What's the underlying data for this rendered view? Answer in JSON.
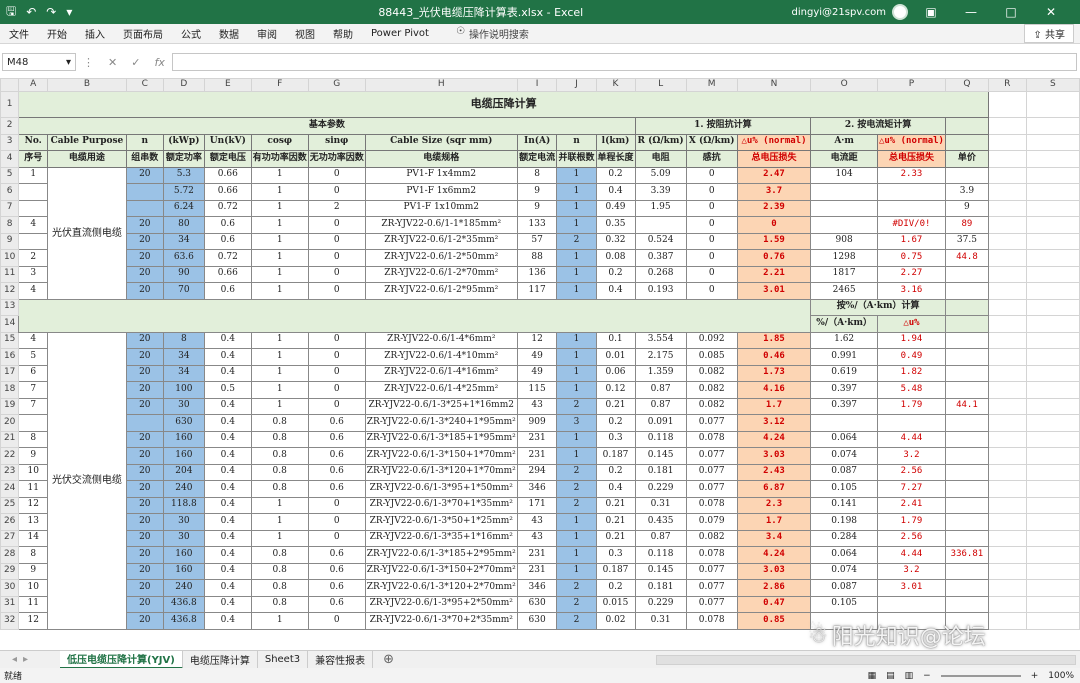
{
  "window": {
    "title": "88443_光伏电缆压降计算表.xlsx  -  Excel",
    "user": "dingyi@21spv.com"
  },
  "ribbon": {
    "tabs": [
      "文件",
      "开始",
      "插入",
      "页面布局",
      "公式",
      "数据",
      "审阅",
      "视图",
      "帮助",
      "Power Pivot"
    ],
    "tell_me": "操作说明搜索",
    "share": "共享"
  },
  "formula_bar": {
    "name_box": "M48",
    "content": ""
  },
  "columns": [
    "A",
    "B",
    "C",
    "D",
    "E",
    "F",
    "G",
    "H",
    "I",
    "J",
    "K",
    "L",
    "M",
    "N",
    "O",
    "P",
    "Q",
    "R",
    "S"
  ],
  "sheet": {
    "title": "电缆压降计算",
    "section_basic": "基本参数",
    "section_imp": "1. 按阻抗计算",
    "section_mom": "2. 按电流矩计算",
    "row3": [
      "No.",
      "Cable Purpose",
      "n",
      "(kWp)",
      "Un(kV)",
      "cosφ",
      "sinφ",
      "Cable Size (sqr mm)",
      "In(A)",
      "n",
      "l(km)",
      "R (Ω/km)",
      "X (Ω/km)",
      "△u% (normal)",
      "A·m",
      "△u% (normal)",
      ""
    ],
    "row4": [
      "序号",
      "电缆用途",
      "组串数",
      "额定功率",
      "额定电压",
      "有功功率因数",
      "无功功率因数",
      "电缆规格",
      "额定电流",
      "并联根数",
      "单程长度",
      "电阻",
      "感抗",
      "总电压损失",
      "电流距",
      "总电压损失",
      "单价"
    ],
    "group_dc": "光伏直流侧电缆",
    "group_ac": "光伏交流侧电缆",
    "band_label": "按%/（A·km）计算",
    "band_sub": "%/（A·km）",
    "band_delta": "△u%",
    "rows_dc": [
      {
        "r": "5",
        "a": "1",
        "c": "20",
        "d": "5.3",
        "e": "0.66",
        "f": "1",
        "g": "0",
        "h": "PV1-F 1x4mm2",
        "i": "8",
        "j": "1",
        "k": "0.2",
        "l": "5.09",
        "m": "0",
        "n": "2.47",
        "o": "104",
        "p": "2.33",
        "q": ""
      },
      {
        "r": "6",
        "a": "",
        "c": "",
        "d": "5.72",
        "e": "0.66",
        "f": "1",
        "g": "0",
        "h": "PV1-F 1x6mm2",
        "i": "9",
        "j": "1",
        "k": "0.4",
        "l": "3.39",
        "m": "0",
        "n": "3.7",
        "o": "",
        "p": "",
        "q": "3.9"
      },
      {
        "r": "7",
        "a": "",
        "c": "",
        "d": "6.24",
        "e": "0.72",
        "f": "1",
        "g": "2",
        "h": "PV1-F 1x10mm2",
        "i": "9",
        "j": "1",
        "k": "0.49",
        "l": "1.95",
        "m": "0",
        "n": "2.39",
        "o": "",
        "p": "",
        "q": "9"
      },
      {
        "r": "8",
        "a": "4",
        "c": "20",
        "d": "80",
        "e": "0.6",
        "f": "1",
        "g": "0",
        "h": "ZR-YJV22-0.6/1-1*185mm²",
        "i": "133",
        "j": "1",
        "k": "0.35",
        "l": "",
        "m": "0",
        "n": "0",
        "o": "",
        "p": "#DIV/0!",
        "q": "89"
      },
      {
        "r": "9",
        "a": "",
        "c": "20",
        "d": "34",
        "e": "0.6",
        "f": "1",
        "g": "0",
        "h": "ZR-YJV22-0.6/1-2*35mm²",
        "i": "57",
        "j": "2",
        "k": "0.32",
        "l": "0.524",
        "m": "0",
        "n": "1.59",
        "o": "908",
        "p": "1.67",
        "q": "37.5"
      },
      {
        "r": "10",
        "a": "2",
        "c": "20",
        "d": "63.6",
        "e": "0.72",
        "f": "1",
        "g": "0",
        "h": "ZR-YJV22-0.6/1-2*50mm²",
        "i": "88",
        "j": "1",
        "k": "0.08",
        "l": "0.387",
        "m": "0",
        "n": "0.76",
        "o": "1298",
        "p": "0.75",
        "q": "44.8"
      },
      {
        "r": "11",
        "a": "3",
        "c": "20",
        "d": "90",
        "e": "0.66",
        "f": "1",
        "g": "0",
        "h": "ZR-YJV22-0.6/1-2*70mm²",
        "i": "136",
        "j": "1",
        "k": "0.2",
        "l": "0.268",
        "m": "0",
        "n": "2.21",
        "o": "1817",
        "p": "2.27",
        "q": ""
      },
      {
        "r": "12",
        "a": "4",
        "c": "20",
        "d": "70",
        "e": "0.6",
        "f": "1",
        "g": "0",
        "h": "ZR-YJV22-0.6/1-2*95mm²",
        "i": "117",
        "j": "1",
        "k": "0.4",
        "l": "0.193",
        "m": "0",
        "n": "3.01",
        "o": "2465",
        "p": "3.16",
        "q": ""
      }
    ],
    "rows_ac": [
      {
        "r": "15",
        "a": "4",
        "c": "20",
        "d": "8",
        "e": "0.4",
        "f": "1",
        "g": "0",
        "h": "ZR-YJV22-0.6/1-4*6mm²",
        "i": "12",
        "j": "1",
        "k": "0.1",
        "l": "3.554",
        "m": "0.092",
        "n": "1.85",
        "o": "1.62",
        "p": "1.94",
        "q": ""
      },
      {
        "r": "16",
        "a": "5",
        "c": "20",
        "d": "34",
        "e": "0.4",
        "f": "1",
        "g": "0",
        "h": "ZR-YJV22-0.6/1-4*10mm²",
        "i": "49",
        "j": "1",
        "k": "0.01",
        "l": "2.175",
        "m": "0.085",
        "n": "0.46",
        "o": "0.991",
        "p": "0.49",
        "q": ""
      },
      {
        "r": "17",
        "a": "6",
        "c": "20",
        "d": "34",
        "e": "0.4",
        "f": "1",
        "g": "0",
        "h": "ZR-YJV22-0.6/1-4*16mm²",
        "i": "49",
        "j": "1",
        "k": "0.06",
        "l": "1.359",
        "m": "0.082",
        "n": "1.73",
        "o": "0.619",
        "p": "1.82",
        "q": ""
      },
      {
        "r": "18",
        "a": "7",
        "c": "20",
        "d": "100",
        "e": "0.5",
        "f": "1",
        "g": "0",
        "h": "ZR-YJV22-0.6/1-4*25mm²",
        "i": "115",
        "j": "1",
        "k": "0.12",
        "l": "0.87",
        "m": "0.082",
        "n": "4.16",
        "o": "0.397",
        "p": "5.48",
        "q": ""
      },
      {
        "r": "19",
        "a": "7",
        "c": "20",
        "d": "30",
        "e": "0.4",
        "f": "1",
        "g": "0",
        "h": "ZR-YJV22-0.6/1-3*25+1*16mm2",
        "i": "43",
        "j": "2",
        "k": "0.21",
        "l": "0.87",
        "m": "0.082",
        "n": "1.7",
        "o": "0.397",
        "p": "1.79",
        "q": "44.1"
      },
      {
        "r": "20",
        "a": "",
        "c": "",
        "d": "630",
        "e": "0.4",
        "f": "0.8",
        "g": "0.6",
        "h": "ZR-YJV22-0.6/1-3*240+1*95mm²",
        "i": "909",
        "j": "3",
        "k": "0.2",
        "l": "0.091",
        "m": "0.077",
        "n": "3.12",
        "o": "",
        "p": "",
        "q": ""
      },
      {
        "r": "21",
        "a": "8",
        "c": "20",
        "d": "160",
        "e": "0.4",
        "f": "0.8",
        "g": "0.6",
        "h": "ZR-YJV22-0.6/1-3*185+1*95mm²",
        "i": "231",
        "j": "1",
        "k": "0.3",
        "l": "0.118",
        "m": "0.078",
        "n": "4.24",
        "o": "0.064",
        "p": "4.44",
        "q": ""
      },
      {
        "r": "22",
        "a": "9",
        "c": "20",
        "d": "160",
        "e": "0.4",
        "f": "0.8",
        "g": "0.6",
        "h": "ZR-YJV22-0.6/1-3*150+1*70mm²",
        "i": "231",
        "j": "1",
        "k": "0.187",
        "l": "0.145",
        "m": "0.077",
        "n": "3.03",
        "o": "0.074",
        "p": "3.2",
        "q": ""
      },
      {
        "r": "23",
        "a": "10",
        "c": "20",
        "d": "204",
        "e": "0.4",
        "f": "0.8",
        "g": "0.6",
        "h": "ZR-YJV22-0.6/1-3*120+1*70mm²",
        "i": "294",
        "j": "2",
        "k": "0.2",
        "l": "0.181",
        "m": "0.077",
        "n": "2.43",
        "o": "0.087",
        "p": "2.56",
        "q": ""
      },
      {
        "r": "24",
        "a": "11",
        "c": "20",
        "d": "240",
        "e": "0.4",
        "f": "0.8",
        "g": "0.6",
        "h": "ZR-YJV22-0.6/1-3*95+1*50mm²",
        "i": "346",
        "j": "2",
        "k": "0.4",
        "l": "0.229",
        "m": "0.077",
        "n": "6.87",
        "o": "0.105",
        "p": "7.27",
        "q": ""
      },
      {
        "r": "25",
        "a": "12",
        "c": "20",
        "d": "118.8",
        "e": "0.4",
        "f": "1",
        "g": "0",
        "h": "ZR-YJV22-0.6/1-3*70+1*35mm²",
        "i": "171",
        "j": "2",
        "k": "0.21",
        "l": "0.31",
        "m": "0.078",
        "n": "2.3",
        "o": "0.141",
        "p": "2.41",
        "q": ""
      },
      {
        "r": "26",
        "a": "13",
        "c": "20",
        "d": "30",
        "e": "0.4",
        "f": "1",
        "g": "0",
        "h": "ZR-YJV22-0.6/1-3*50+1*25mm²",
        "i": "43",
        "j": "1",
        "k": "0.21",
        "l": "0.435",
        "m": "0.079",
        "n": "1.7",
        "o": "0.198",
        "p": "1.79",
        "q": ""
      },
      {
        "r": "27",
        "a": "14",
        "c": "20",
        "d": "30",
        "e": "0.4",
        "f": "1",
        "g": "0",
        "h": "ZR-YJV22-0.6/1-3*35+1*16mm²",
        "i": "43",
        "j": "1",
        "k": "0.21",
        "l": "0.87",
        "m": "0.082",
        "n": "3.4",
        "o": "0.284",
        "p": "2.56",
        "q": ""
      },
      {
        "r": "28",
        "a": "8",
        "c": "20",
        "d": "160",
        "e": "0.4",
        "f": "0.8",
        "g": "0.6",
        "h": "ZR-YJV22-0.6/1-3*185+2*95mm²",
        "i": "231",
        "j": "1",
        "k": "0.3",
        "l": "0.118",
        "m": "0.078",
        "n": "4.24",
        "o": "0.064",
        "p": "4.44",
        "q": "336.81"
      },
      {
        "r": "29",
        "a": "9",
        "c": "20",
        "d": "160",
        "e": "0.4",
        "f": "0.8",
        "g": "0.6",
        "h": "ZR-YJV22-0.6/1-3*150+2*70mm²",
        "i": "231",
        "j": "1",
        "k": "0.187",
        "l": "0.145",
        "m": "0.077",
        "n": "3.03",
        "o": "0.074",
        "p": "3.2",
        "q": ""
      },
      {
        "r": "30",
        "a": "10",
        "c": "20",
        "d": "240",
        "e": "0.4",
        "f": "0.8",
        "g": "0.6",
        "h": "ZR-YJV22-0.6/1-3*120+2*70mm²",
        "i": "346",
        "j": "2",
        "k": "0.2",
        "l": "0.181",
        "m": "0.077",
        "n": "2.86",
        "o": "0.087",
        "p": "3.01",
        "q": ""
      },
      {
        "r": "31",
        "a": "11",
        "c": "20",
        "d": "436.8",
        "e": "0.4",
        "f": "0.8",
        "g": "0.6",
        "h": "ZR-YJV22-0.6/1-3*95+2*50mm²",
        "i": "630",
        "j": "2",
        "k": "0.015",
        "l": "0.229",
        "m": "0.077",
        "n": "0.47",
        "o": "0.105",
        "p": "",
        "q": ""
      },
      {
        "r": "32",
        "a": "12",
        "c": "20",
        "d": "436.8",
        "e": "0.4",
        "f": "1",
        "g": "0",
        "h": "ZR-YJV22-0.6/1-3*70+2*35mm²",
        "i": "630",
        "j": "2",
        "k": "0.02",
        "l": "0.31",
        "m": "0.078",
        "n": "0.85",
        "o": "",
        "p": "",
        "q": ""
      }
    ]
  },
  "sheet_tabs": [
    "低压电缆压降计算(YJV)",
    "电缆压降计算",
    "Sheet3",
    "兼容性报表"
  ],
  "status": {
    "left": "就绪",
    "zoom": "100%"
  },
  "watermark": "阳光知识@论坛",
  "colors": {
    "excel_green": "#217346",
    "header_green": "#e2efda",
    "input_blue": "#9bc2e6",
    "result_pink": "#fcd5b4",
    "error_red": "#d00000"
  }
}
